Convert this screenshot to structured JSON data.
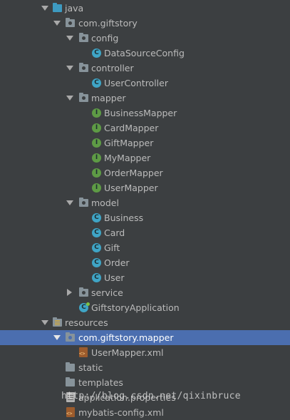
{
  "project_tree": {
    "items": [
      {
        "label": "java",
        "icon": "source-folder-icon",
        "expanded": true
      },
      {
        "label": "com.giftstory",
        "icon": "package-icon",
        "expanded": true
      },
      {
        "label": "config",
        "icon": "package-icon",
        "expanded": true
      },
      {
        "label": "DataSourceConfig",
        "icon": "class-icon"
      },
      {
        "label": "controller",
        "icon": "package-icon",
        "expanded": true
      },
      {
        "label": "UserController",
        "icon": "class-icon"
      },
      {
        "label": "mapper",
        "icon": "package-icon",
        "expanded": true
      },
      {
        "label": "BusinessMapper",
        "icon": "interface-icon"
      },
      {
        "label": "CardMapper",
        "icon": "interface-icon"
      },
      {
        "label": "GiftMapper",
        "icon": "interface-icon"
      },
      {
        "label": "MyMapper",
        "icon": "interface-icon"
      },
      {
        "label": "OrderMapper",
        "icon": "interface-icon"
      },
      {
        "label": "UserMapper",
        "icon": "interface-icon"
      },
      {
        "label": "model",
        "icon": "package-icon",
        "expanded": true
      },
      {
        "label": "Business",
        "icon": "class-icon"
      },
      {
        "label": "Card",
        "icon": "class-icon"
      },
      {
        "label": "Gift",
        "icon": "class-icon"
      },
      {
        "label": "Order",
        "icon": "class-icon"
      },
      {
        "label": "User",
        "icon": "class-icon"
      },
      {
        "label": "service",
        "icon": "package-icon",
        "expanded": false
      },
      {
        "label": "GiftstoryApplication",
        "icon": "spring-boot-class-icon"
      },
      {
        "label": "resources",
        "icon": "resources-folder-icon",
        "expanded": true
      },
      {
        "label": "com.giftstory.mapper",
        "icon": "package-icon",
        "expanded": true,
        "selected": true
      },
      {
        "label": "UserMapper.xml",
        "icon": "xml-file-icon"
      },
      {
        "label": "static",
        "icon": "folder-icon"
      },
      {
        "label": "templates",
        "icon": "folder-icon"
      },
      {
        "label": "application.properties",
        "icon": "properties-file-icon"
      },
      {
        "label": "mybatis-config.xml",
        "icon": "xml-file-icon"
      }
    ],
    "class_glyph": "C",
    "interface_glyph": "I"
  },
  "watermark": "http://blog.csdn.net/qixinbruce",
  "colors": {
    "background": "#3c3f41",
    "selection": "#4b6eaf",
    "text": "#bbbbbb",
    "class_icon": "#3fa5c6",
    "interface_icon": "#5e9b45"
  }
}
